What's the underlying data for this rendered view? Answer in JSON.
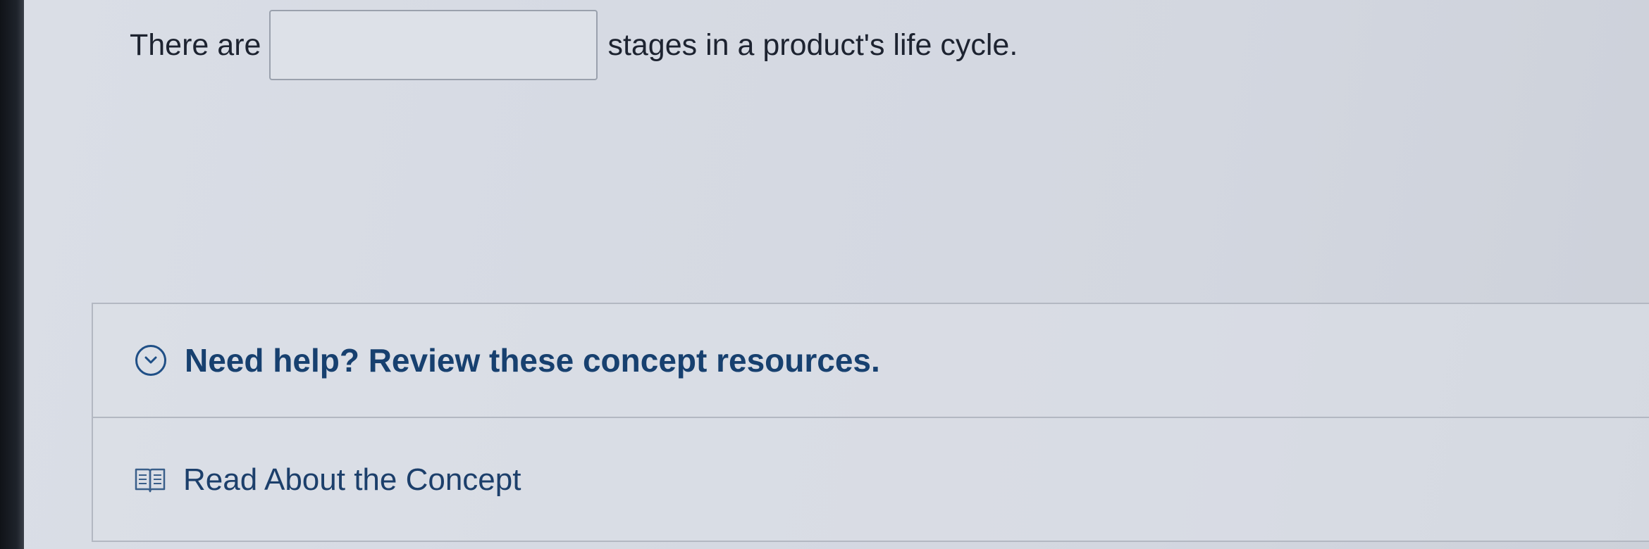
{
  "question": {
    "prefix": "There are",
    "answer_value": "",
    "suffix": "stages in a product's life cycle."
  },
  "help": {
    "title": "Need help? Review these concept resources.",
    "toggle_icon": "chevron-down-icon",
    "resources": [
      {
        "label": "Read About the Concept",
        "icon": "book-icon"
      }
    ]
  },
  "colors": {
    "accent": "#17406f",
    "background": "#d9dde5",
    "border": "#b3b8c2"
  }
}
